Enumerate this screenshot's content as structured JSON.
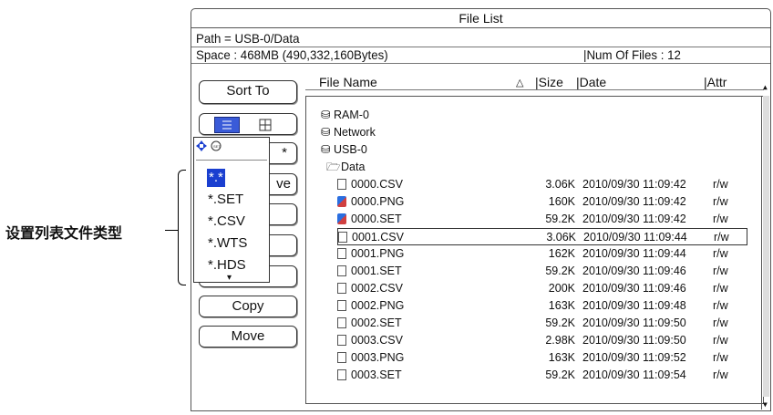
{
  "window": {
    "title": "File List"
  },
  "info": {
    "path": "Path = USB-0/Data",
    "space": "Space : 468MB (490,332,160Bytes)",
    "num_files": "|Num Of Files : 12"
  },
  "sidebar": {
    "sort_to": "Sort To",
    "copy": "Copy",
    "move": "Move",
    "hidden_partial_1": "*",
    "hidden_partial_2": "ve",
    "view_list_icon": "list-view-icon",
    "view_grid_icon": "grid-view-icon"
  },
  "popup": {
    "header_icon": "jog-set-icon",
    "items": [
      "*.*",
      "*.SET",
      "*.CSV",
      "*.WTS",
      "*.HDS"
    ],
    "more_indicator": "▾"
  },
  "columns": {
    "name": "File Name",
    "sort_arrow": "△",
    "size": "|Size",
    "date": "|Date",
    "attr": "|Attr"
  },
  "drives": [
    "RAM-0",
    "Network",
    "USB-0"
  ],
  "folder": "Data",
  "files": [
    {
      "name": "0000.CSV",
      "size": "3.06K",
      "date": "2010/09/30 11:09:42",
      "attr": "r/w",
      "icon": "file-icon"
    },
    {
      "name": "0000.PNG",
      "size": "160K",
      "date": "2010/09/30 11:09:42",
      "attr": "r/w",
      "icon": "image-file-icon"
    },
    {
      "name": "0000.SET",
      "size": "59.2K",
      "date": "2010/09/30 11:09:42",
      "attr": "r/w",
      "icon": "setup-file-icon"
    },
    {
      "name": "0001.CSV",
      "size": "3.06K",
      "date": "2010/09/30 11:09:44",
      "attr": "r/w",
      "icon": "file-icon"
    },
    {
      "name": "0001.PNG",
      "size": "162K",
      "date": "2010/09/30 11:09:44",
      "attr": "r/w",
      "icon": "file-icon"
    },
    {
      "name": "0001.SET",
      "size": "59.2K",
      "date": "2010/09/30 11:09:46",
      "attr": "r/w",
      "icon": "file-icon"
    },
    {
      "name": "0002.CSV",
      "size": "200K",
      "date": "2010/09/30 11:09:46",
      "attr": "r/w",
      "icon": "file-icon"
    },
    {
      "name": "0002.PNG",
      "size": "163K",
      "date": "2010/09/30 11:09:48",
      "attr": "r/w",
      "icon": "file-icon"
    },
    {
      "name": "0002.SET",
      "size": "59.2K",
      "date": "2010/09/30 11:09:50",
      "attr": "r/w",
      "icon": "file-icon"
    },
    {
      "name": "0003.CSV",
      "size": "2.98K",
      "date": "2010/09/30 11:09:50",
      "attr": "r/w",
      "icon": "file-icon"
    },
    {
      "name": "0003.PNG",
      "size": "163K",
      "date": "2010/09/30 11:09:52",
      "attr": "r/w",
      "icon": "file-icon"
    },
    {
      "name": "0003.SET",
      "size": "59.2K",
      "date": "2010/09/30 11:09:54",
      "attr": "r/w",
      "icon": "file-icon"
    }
  ],
  "callout": "设置列表文件类型"
}
